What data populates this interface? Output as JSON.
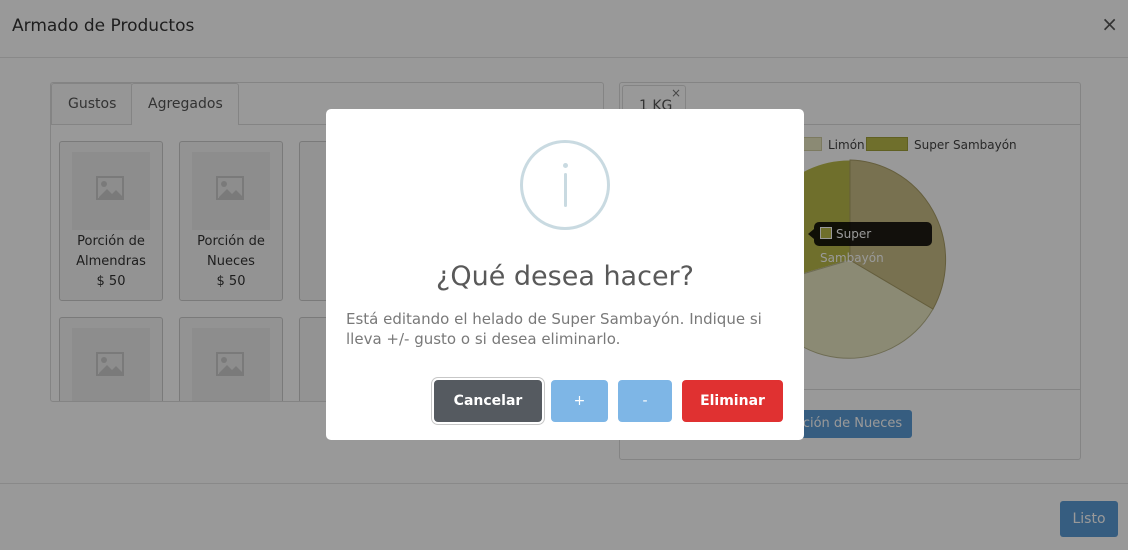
{
  "modal": {
    "title": "Armado de Productos",
    "close": "×"
  },
  "left_panel": {
    "tabs": [
      {
        "label": "Gustos"
      },
      {
        "label": "Agregados"
      }
    ],
    "products": [
      {
        "name_line1": "Porción de",
        "name_line2": "Almendras",
        "price": "$ 50"
      },
      {
        "name_line1": "Porción de",
        "name_line2": "Nueces",
        "price": "$ 50"
      }
    ]
  },
  "right_panel": {
    "tab_label": "1 KG",
    "tab_close": "×",
    "chart_data": {
      "type": "pie",
      "legend": [
        {
          "name": "Limón",
          "color": "#e8e6c2"
        },
        {
          "name": "Super Sambayón",
          "color": "#b9b94a"
        }
      ],
      "tooltip": "Super Sambayón"
    },
    "addon_button": "orción de Nueces"
  },
  "footer": {
    "done_label": "Listo"
  },
  "dialog": {
    "title": "¿Qué desea hacer?",
    "text": "Está editando el helado de Super Sambayón. Indique si lleva +/- gusto o si desea eliminarlo.",
    "buttons": {
      "cancel": "Cancelar",
      "plus": "+",
      "minus": "-",
      "delete": "Eliminar"
    }
  },
  "colors": {
    "cancel": "#555a60",
    "plus_minus": "#7eb6e6",
    "delete": "#e03131",
    "primary": "#5b9bd5"
  }
}
